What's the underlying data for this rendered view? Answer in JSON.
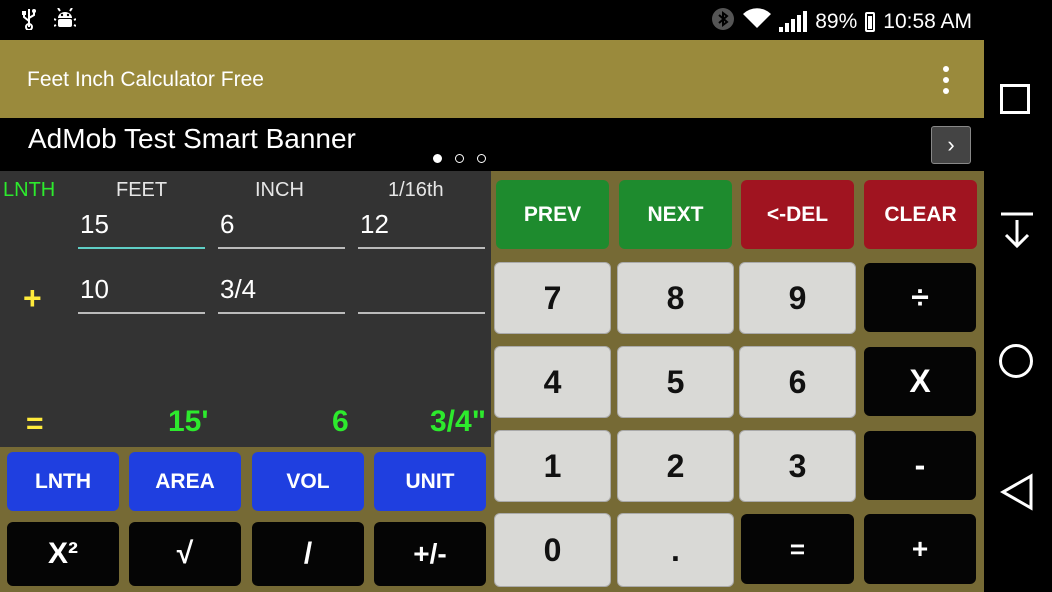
{
  "status_bar": {
    "icons_left": [
      "usb-icon",
      "android-debug-icon"
    ],
    "icons_right": [
      "bluetooth-icon",
      "wifi-icon",
      "signal-icon",
      "battery-charging-icon"
    ],
    "battery": "89%",
    "time": "10:58 AM"
  },
  "app_bar": {
    "title": "Feet Inch Calculator Free",
    "menu_icon": "overflow-menu-icon"
  },
  "banner": {
    "text": "AdMob Test Smart Banner",
    "next_icon": "chevron-right-icon",
    "pages": 3,
    "current_page": 1
  },
  "input": {
    "mode_label": "LNTH",
    "headers": {
      "feet": "FEET",
      "inch": "INCH",
      "sixteenth": "1/16th"
    },
    "row1": {
      "feet": "15",
      "inch": "6",
      "sixteenth": "12"
    },
    "operator": "+",
    "row2": {
      "feet": "10",
      "inch": "3/4",
      "sixteenth": ""
    },
    "equals": "=",
    "result": {
      "feet": "15'",
      "inch": "6",
      "fraction": "3/4\""
    }
  },
  "keys": {
    "prev": "PREV",
    "next": "NEXT",
    "del": "<-DEL",
    "clear": "CLEAR",
    "n7": "7",
    "n8": "8",
    "n9": "9",
    "divide": "÷",
    "n4": "4",
    "n5": "5",
    "n6": "6",
    "multiply": "X",
    "n1": "1",
    "n2": "2",
    "n3": "3",
    "minus": "-",
    "n0": "0",
    "dot": ".",
    "equals": "=",
    "plus": "+",
    "lnth": "LNTH",
    "area": "AREA",
    "vol": "VOL",
    "unit": "UNIT",
    "square": "X²",
    "sqrt": "√",
    "slash": "/",
    "sign": "+/-"
  },
  "nav_bar": {
    "icons": [
      "recents-square-icon",
      "notification-pull-down-icon",
      "home-circle-icon",
      "back-triangle-icon"
    ]
  },
  "colors": {
    "app_bar": "#9a8a3c",
    "keypad_bg": "#766a35",
    "green": "#1e8b2e",
    "red": "#a01420",
    "blue": "#1f3fe0",
    "result": "#2dea2d",
    "operator": "#ffeb3b"
  }
}
